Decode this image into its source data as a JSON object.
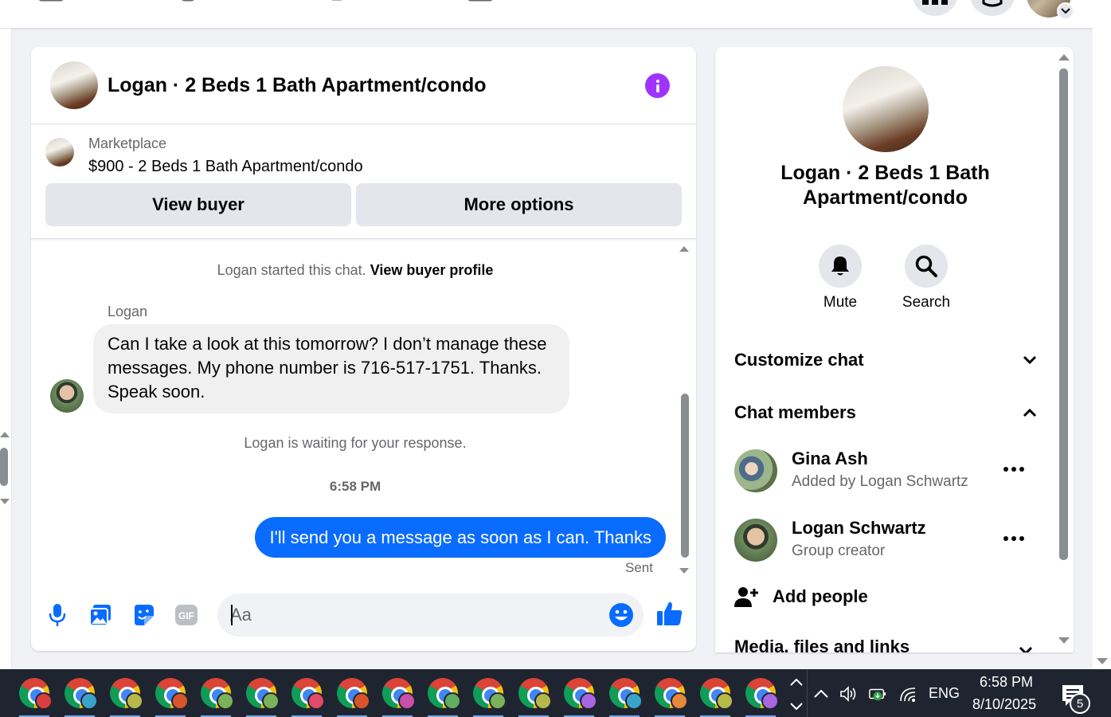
{
  "chat": {
    "title": "Logan · 2 Beds 1 Bath Apartment/condo",
    "listing": {
      "category": "Marketplace",
      "title": "$900 - 2 Beds 1 Bath Apartment/condo",
      "view_buyer_label": "View buyer",
      "more_options_label": "More options"
    },
    "messages": {
      "started_text": "Logan started this chat.",
      "view_profile_link": "View buyer profile",
      "sender_name": "Logan",
      "incoming_text": "Can I take a look at this tomorrow? I don’t manage these messages. My phone number is 716-517-1751. Thanks. Speak soon.",
      "waiting_text": "Logan is waiting for your response.",
      "timestamp": "6:58 PM",
      "outgoing_text": "I'll send you a message as soon as I can. Thanks",
      "status": "Sent"
    },
    "composer": {
      "placeholder": "Aa",
      "gif_label": "GIF"
    }
  },
  "side_panel": {
    "title": "Logan · 2 Beds 1 Bath Apartment/condo",
    "actions": [
      {
        "label": "Mute",
        "icon": "bell-icon"
      },
      {
        "label": "Search",
        "icon": "search-icon"
      }
    ],
    "sections": {
      "customize": "Customize chat",
      "members": "Chat members",
      "media": "Media, files and links"
    },
    "members": [
      {
        "name": "Gina Ash",
        "subtitle": "Added by Logan Schwartz"
      },
      {
        "name": "Logan Schwartz",
        "subtitle": "Group creator"
      }
    ],
    "add_people": "Add people"
  },
  "taskbar": {
    "language": "ENG",
    "time": "6:58 PM",
    "date": "8/10/2025",
    "notification_count": "5",
    "chrome_profile_colors": [
      "#d93f3f",
      "#3aa3c9",
      "#b7b84a",
      "#d9542b",
      "#7ab35a",
      "#7ab35a",
      "#e04b6a",
      "#d9542b",
      "#c94fa8",
      "#5fae5f",
      "#7ab35a",
      "#b7b84a",
      "#a866e0",
      "#3aa3c9",
      "#e6893a",
      "#b7b84a",
      "#a866e0"
    ]
  },
  "colors": {
    "accent_blue": "#0a6cff",
    "info_purple": "#a033ff"
  }
}
